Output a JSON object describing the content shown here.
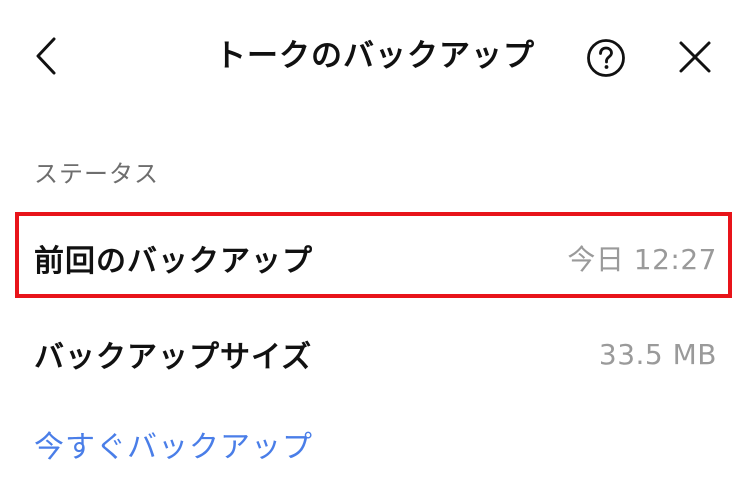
{
  "header": {
    "title": "トークのバックアップ",
    "back_icon": "chevron-left-icon",
    "help_icon": "question-circle-icon",
    "close_icon": "close-icon"
  },
  "status_section": {
    "label": "ステータス",
    "rows": [
      {
        "label": "前回のバックアップ",
        "value": "今日 12:27"
      },
      {
        "label": "バックアップサイズ",
        "value": "33.5 MB"
      }
    ]
  },
  "actions": {
    "backup_now_label": "今すぐバックアップ"
  },
  "colors": {
    "link": "#4a7ee8",
    "highlight": "#e8141a",
    "secondary_text": "#9a9a9a",
    "section_text": "#6e6e6e"
  }
}
